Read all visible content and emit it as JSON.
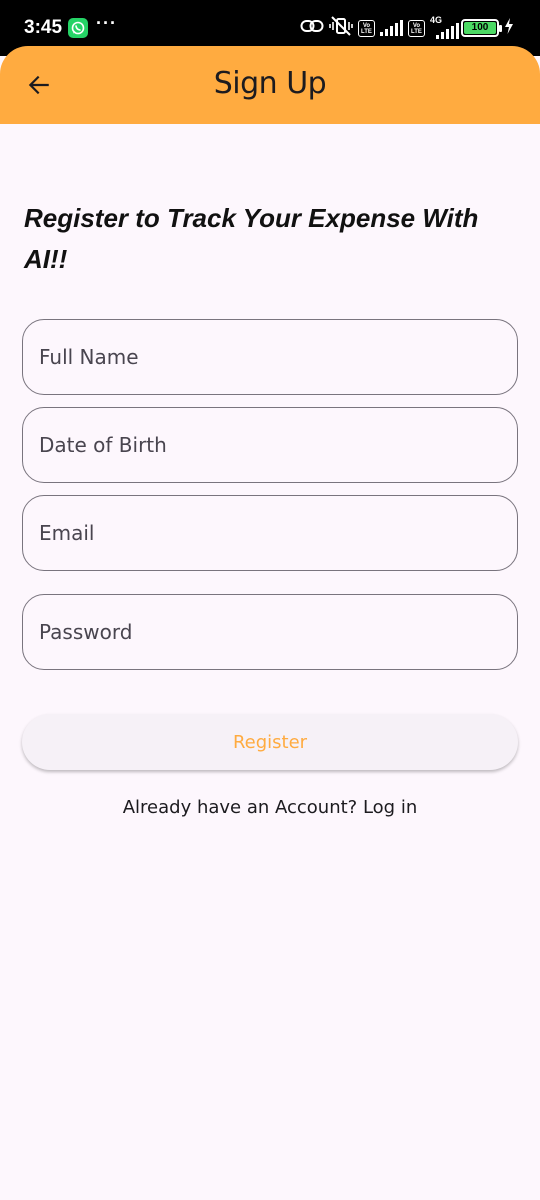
{
  "status_bar": {
    "time": "3:45",
    "more_indicator": "···",
    "volte_label": "Vo LTE",
    "network_label": "4G",
    "battery_level": "100",
    "icons": [
      "whatsapp-icon",
      "link-icon",
      "vibrate-off-icon",
      "signal-icon",
      "battery-icon",
      "charging-icon"
    ]
  },
  "app_bar": {
    "title": "Sign Up",
    "back_icon": "arrow-back-icon",
    "background_color": "#ffab40"
  },
  "form": {
    "headline": "Register to Track Your Expense With AI!!",
    "full_name_placeholder": "Full Name",
    "dob_placeholder": "Date of Birth",
    "email_placeholder": "Email",
    "password_placeholder": "Password",
    "register_label": "Register",
    "login_prompt": "Already have an Account? Log in"
  },
  "colors": {
    "accent": "#ffab40",
    "background": "#fdf7fd",
    "outline": "#79747e"
  }
}
